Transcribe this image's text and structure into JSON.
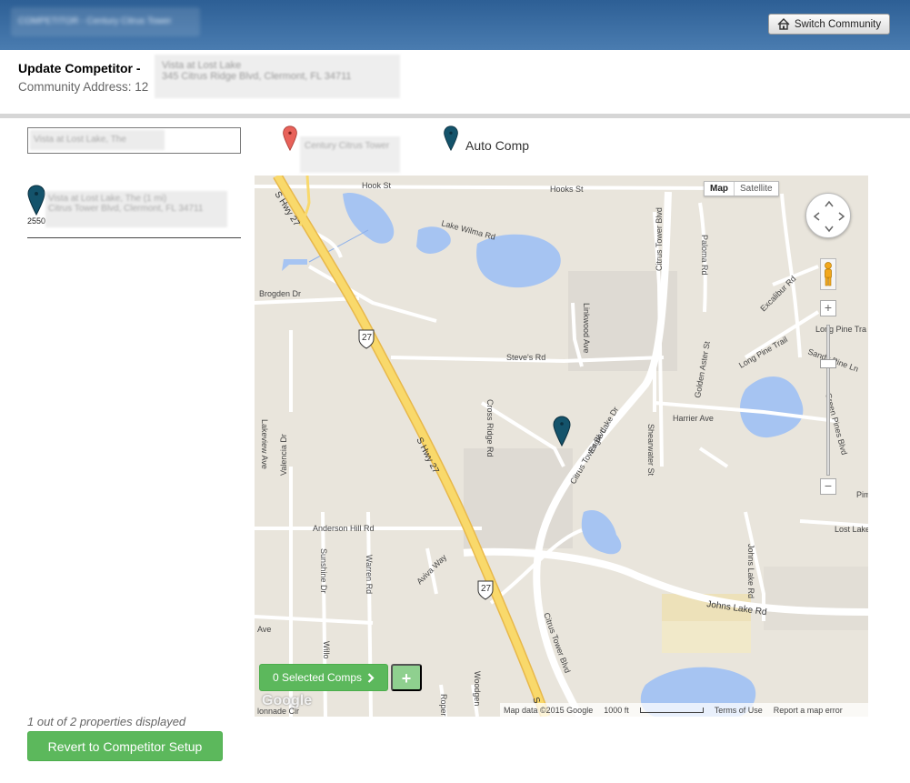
{
  "topbar": {
    "brand_text": "COMPETITOR - Century Citrus Tower",
    "switch_label": "Switch Community"
  },
  "header": {
    "title": "Update Competitor -",
    "title_blurred": "Vista at Lost Lake",
    "address_label": "Community Address: 12",
    "address_blurred": "345 Citrus Ridge Blvd, Clermont, FL 34711"
  },
  "search": {
    "value_blurred": "Vista at Lost Lake, The"
  },
  "list": {
    "prefix": "2550",
    "item_blurred_name": "Vista at Lost Lake, The (1 mi)",
    "item_blurred_address": "Citrus Tower Blvd, Clermont, FL 34711"
  },
  "legend": {
    "red_label_blurred": "Century Citrus Tower",
    "blue_label": "Auto Comp"
  },
  "map": {
    "type_map": "Map",
    "type_satellite": "Satellite",
    "zoom_in": "+",
    "zoom_out": "−",
    "selected_comps_label": "0 Selected Comps",
    "plus_label": "+",
    "google_logo": "Google",
    "attribution": "Map data ©2015 Google",
    "scale_label": "1000 ft",
    "terms": "Terms of Use",
    "report": "Report a map error",
    "roads": {
      "hook_st": "Hook St",
      "hooks_st": "Hooks St",
      "lake_wilma": "Lake Wilma Rd",
      "brogden": "Brogden Dr",
      "steves": "Steve's Rd",
      "lakeview": "Lakeview Ave",
      "cross_ridge": "Cross Ridge Rd",
      "linkwood": "Linkwood Ave",
      "citrus_tower_v": "Citrus Tower Blvd",
      "citrus_tower_d": "Citrus Tower Blvd",
      "citrus_tower_b": "Citrus Tower Blvd",
      "eagle_lake": "Eagle Lake Dr",
      "palomar": "Paloma Rd",
      "excalibur": "Excalibur Rd",
      "long_pine": "Long Pine Trail",
      "long_pine_r": "Long Pine Tra",
      "sandy_pine": "Sandy Pine Ln",
      "golden_aster": "Golden Aster St",
      "harrier": "Harrier Ave",
      "shearwater": "Shearwater St",
      "green_pines": "Green Pines Blvd",
      "s_hwy_27_top": "S Hwy 27",
      "s_hwy_27_mid": "S Hwy 27",
      "s_hwy_27_bot": "S",
      "shield": "27",
      "valencia": "Valencia Dr",
      "anderson": "Anderson Hill Rd",
      "sunshine": "Sunshine Dr",
      "warren": "Warren Rd",
      "aviva": "Aviva Way",
      "johns_lake_v": "Johns Lake Rd",
      "johns_lake_h": "Johns Lake Rd",
      "lost_lake": "Lost Lake",
      "pim": "Pim",
      "willo": "Willo",
      "woodgen": "Woodgen",
      "roper": "Roper",
      "ave": "Ave",
      "colonnade": "lonnade Cir"
    }
  },
  "footer": {
    "count_text": "1 out of 2 properties displayed",
    "revert_label": "Revert to Competitor Setup"
  },
  "colors": {
    "topbar": "#3a6ea5",
    "green_button": "#5cb85c",
    "pin_blue": "#14536b",
    "pin_red": "#e8625a",
    "water": "#a6c4f2",
    "highway": "#f9d96b"
  }
}
